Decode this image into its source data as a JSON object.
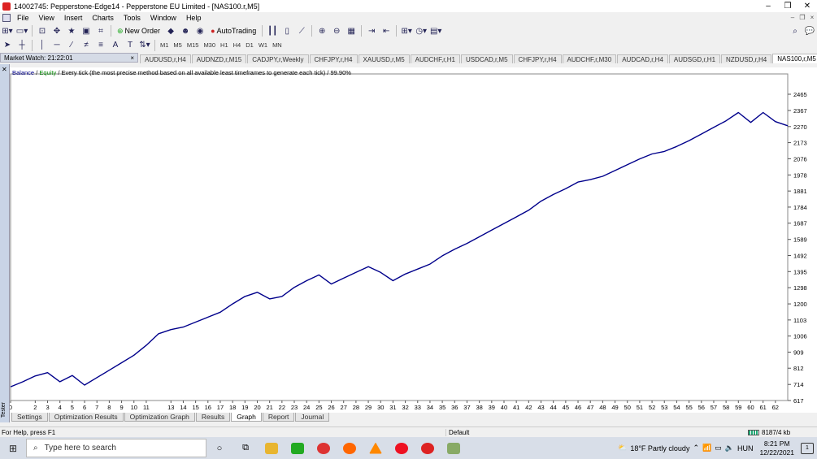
{
  "window": {
    "title": "14002745: Pepperstone-Edge14 - Pepperstone EU Limited - [NAS100.r,M5]",
    "minimize": "–",
    "maximize": "❒",
    "close": "✕"
  },
  "menu": {
    "items": [
      "File",
      "View",
      "Insert",
      "Charts",
      "Tools",
      "Window",
      "Help"
    ],
    "mdi": [
      "–",
      "❐",
      "×"
    ]
  },
  "toolbar": {
    "new_order": "New Order",
    "autotrading": "AutoTrading"
  },
  "timeframes": [
    "M1",
    "M5",
    "M15",
    "M30",
    "H1",
    "H4",
    "D1",
    "W1",
    "MN"
  ],
  "market_watch": {
    "title": "Market Watch: 21:22:01",
    "close": "×"
  },
  "chart_tabs": [
    "AUDUSD,r,H4",
    "AUDNZD,r,M15",
    "CADJPY,r,Weekly",
    "CHFJPY,r,H4",
    "XAUUSD,r,M5",
    "AUDCHF,r,H1",
    "USDCAD,r,M5",
    "CHFJPY,r,H4",
    "AUDCHF,r,M30",
    "AUDCAD,r,H4",
    "AUDSGD,r,H1",
    "NZDUSD,r,H4",
    "NAS100,r,M5"
  ],
  "active_chart_tab": 12,
  "graph": {
    "legend_balance": "Balance",
    "legend_sep": " / ",
    "legend_equity": "Equity",
    "legend_text": " / Every tick (the most precise method based on all available least timeframes to generate each tick) / 99.90%"
  },
  "chart_data": {
    "type": "line",
    "line_color": "#00008b",
    "x_ticks": [
      0,
      2,
      3,
      4,
      5,
      6,
      7,
      8,
      9,
      10,
      11,
      13,
      14,
      15,
      16,
      17,
      18,
      19,
      20,
      21,
      22,
      23,
      24,
      25,
      26,
      27,
      28,
      29,
      30,
      31,
      32,
      33,
      34,
      35,
      36,
      37,
      38,
      39,
      40,
      41,
      42,
      43,
      44,
      45,
      46,
      47,
      48,
      49,
      50,
      51,
      52,
      53,
      54,
      55,
      56,
      57,
      58,
      59,
      60,
      61,
      62
    ],
    "y_ticks": [
      617,
      714,
      812,
      909,
      1006,
      1103,
      1200,
      1298,
      1395,
      1492,
      1589,
      1687,
      1784,
      1881,
      1978,
      2076,
      2173,
      2270,
      2367,
      2465
    ],
    "ylim": [
      617,
      2568
    ],
    "xlim": [
      0,
      63
    ],
    "series": [
      {
        "values": [
          [
            0,
            700
          ],
          [
            1,
            730
          ],
          [
            2,
            765
          ],
          [
            3,
            785
          ],
          [
            4,
            730
          ],
          [
            5,
            768
          ],
          [
            6,
            710
          ],
          [
            7,
            755
          ],
          [
            8,
            800
          ],
          [
            9,
            845
          ],
          [
            10,
            890
          ],
          [
            11,
            950
          ],
          [
            12,
            1020
          ],
          [
            13,
            1045
          ],
          [
            14,
            1060
          ],
          [
            15,
            1090
          ],
          [
            16,
            1120
          ],
          [
            17,
            1150
          ],
          [
            18,
            1200
          ],
          [
            19,
            1245
          ],
          [
            20,
            1270
          ],
          [
            21,
            1230
          ],
          [
            22,
            1245
          ],
          [
            23,
            1300
          ],
          [
            24,
            1340
          ],
          [
            25,
            1375
          ],
          [
            26,
            1320
          ],
          [
            27,
            1355
          ],
          [
            28,
            1390
          ],
          [
            29,
            1425
          ],
          [
            30,
            1390
          ],
          [
            31,
            1340
          ],
          [
            32,
            1380
          ],
          [
            33,
            1410
          ],
          [
            34,
            1440
          ],
          [
            35,
            1490
          ],
          [
            36,
            1530
          ],
          [
            37,
            1565
          ],
          [
            38,
            1605
          ],
          [
            39,
            1645
          ],
          [
            40,
            1685
          ],
          [
            41,
            1725
          ],
          [
            42,
            1765
          ],
          [
            43,
            1820
          ],
          [
            44,
            1860
          ],
          [
            45,
            1895
          ],
          [
            46,
            1935
          ],
          [
            47,
            1950
          ],
          [
            48,
            1970
          ],
          [
            49,
            2005
          ],
          [
            50,
            2040
          ],
          [
            51,
            2075
          ],
          [
            52,
            2105
          ],
          [
            53,
            2120
          ],
          [
            54,
            2150
          ],
          [
            55,
            2185
          ],
          [
            56,
            2225
          ],
          [
            57,
            2265
          ],
          [
            58,
            2305
          ],
          [
            59,
            2355
          ],
          [
            60,
            2295
          ],
          [
            61,
            2355
          ],
          [
            62,
            2300
          ],
          [
            63,
            2275
          ]
        ]
      }
    ]
  },
  "tester_tabs": [
    "Settings",
    "Optimization Results",
    "Optimization Graph",
    "Results",
    "Graph",
    "Report",
    "Journal"
  ],
  "active_tester_tab": 4,
  "tester_label": "Tester",
  "status": {
    "help": "For Help, press F1",
    "profile": "Default",
    "traffic": "8187/4 kb"
  },
  "taskbar": {
    "search_placeholder": "Type here to search",
    "weather": "18°F  Partly cloudy",
    "lang": "HUN",
    "time": "8:21 PM",
    "date": "12/22/2021",
    "notif_count": "1"
  }
}
